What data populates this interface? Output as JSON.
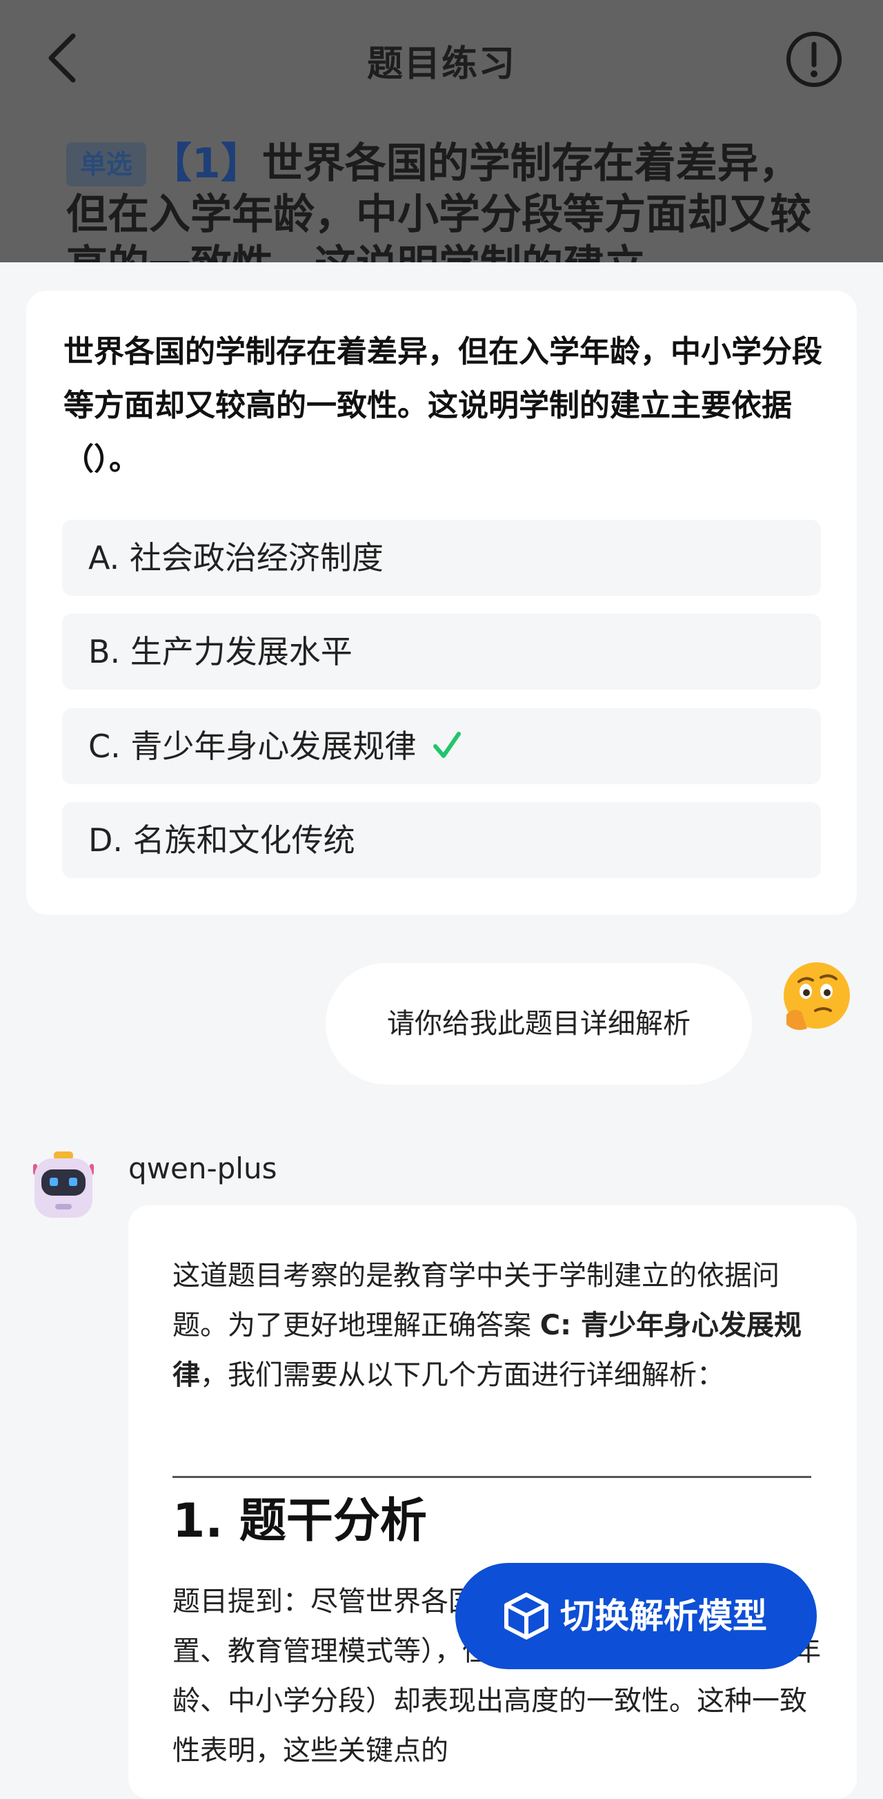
{
  "header": {
    "title": "题目练习"
  },
  "background_question": {
    "badge": "单选",
    "number": "【1】",
    "text": "世界各国的学制存在着差异，但在入学年龄，中小学分段等方面却又较高的一致性。这说明学制的建立"
  },
  "question": {
    "text": "世界各国的学制存在着差异，但在入学年龄，中小学分段等方面却又较高的一致性。这说明学制的建立主要依据（）。",
    "options": [
      {
        "label": "A. 社会政治经济制度",
        "correct": false
      },
      {
        "label": "B. 生产力发展水平",
        "correct": false
      },
      {
        "label": "C. 青少年身心发展规律",
        "correct": true
      },
      {
        "label": "D. 名族和文化传统",
        "correct": false
      }
    ],
    "check_color": "#22c56b"
  },
  "chat": {
    "user_message": "请你给我此题目详细解析",
    "user_avatar_icon": "thinking-face-emoji",
    "bot_name": "qwen-plus",
    "bot_avatar_icon": "robot-icon",
    "answer": {
      "intro_1": "这道题目考察的是教育学中关于学制建立的依据问题。为了更好地理解正确答案 ",
      "intro_bold": "C: 青少年身心发展规律",
      "intro_2": "，我们需要从以下几个方面进行详细解析：",
      "section_title": "1. 题干分析",
      "section_text": "题目提到：尽管世界各国的学制存在差异（如课程设置、教育管理模式等），但在某些关键点上（如入学年龄、中小学分段）却表现出高度的一致性。这种一致性表明，这些关键点的"
    }
  },
  "fab": {
    "label": "切换解析模型",
    "icon": "cube-icon",
    "color": "#0d4fd6"
  }
}
